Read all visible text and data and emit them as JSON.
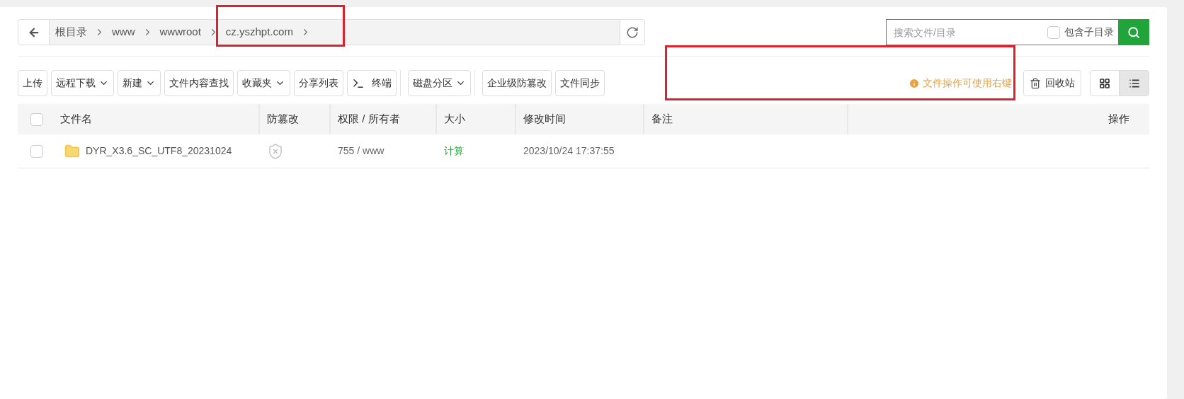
{
  "breadcrumb": [
    {
      "label": "根目录",
      "highlighted": false
    },
    {
      "label": "www",
      "highlighted": false
    },
    {
      "label": "wwwroot",
      "highlighted": false
    },
    {
      "label": "cz.yszhpt.com",
      "highlighted": true
    }
  ],
  "search": {
    "placeholder": "搜索文件/目录",
    "include_subdirs": {
      "label": "包含子目录",
      "checked": false
    }
  },
  "toolbar_groups": [
    [
      {
        "label": "上传",
        "kind": "button"
      },
      {
        "label": "远程下载",
        "kind": "dropdown"
      },
      {
        "label": "新建",
        "kind": "dropdown"
      },
      {
        "label": "文件内容查找",
        "kind": "button"
      },
      {
        "label": "收藏夹",
        "kind": "dropdown"
      },
      {
        "label": "分享列表",
        "kind": "button"
      },
      {
        "label": "终端",
        "kind": "terminal"
      }
    ],
    [
      {
        "label": "磁盘分区",
        "kind": "dropdown"
      }
    ],
    [
      {
        "label": "企业级防篡改",
        "kind": "button"
      },
      {
        "label": "文件同步",
        "kind": "button"
      }
    ]
  ],
  "hint": {
    "text": "文件操作可使用右键",
    "highlighted": true
  },
  "recycle_bin": "回收站",
  "view_modes": [
    {
      "kind": "grid",
      "selected": false
    },
    {
      "kind": "list",
      "selected": true
    }
  ],
  "table": {
    "select_all_checked": false,
    "columns": [
      "文件名",
      "防篡改",
      "权限 / 所有者",
      "大小",
      "修改时间",
      "备注",
      "操作"
    ],
    "rows": [
      {
        "checked": false,
        "name": "DYR_X3.6_SC_UTF8_20231024",
        "tamper_protected": false,
        "permission": "755 / www",
        "size": "计算",
        "modified": "2023/10/24 17:37:55"
      }
    ]
  }
}
